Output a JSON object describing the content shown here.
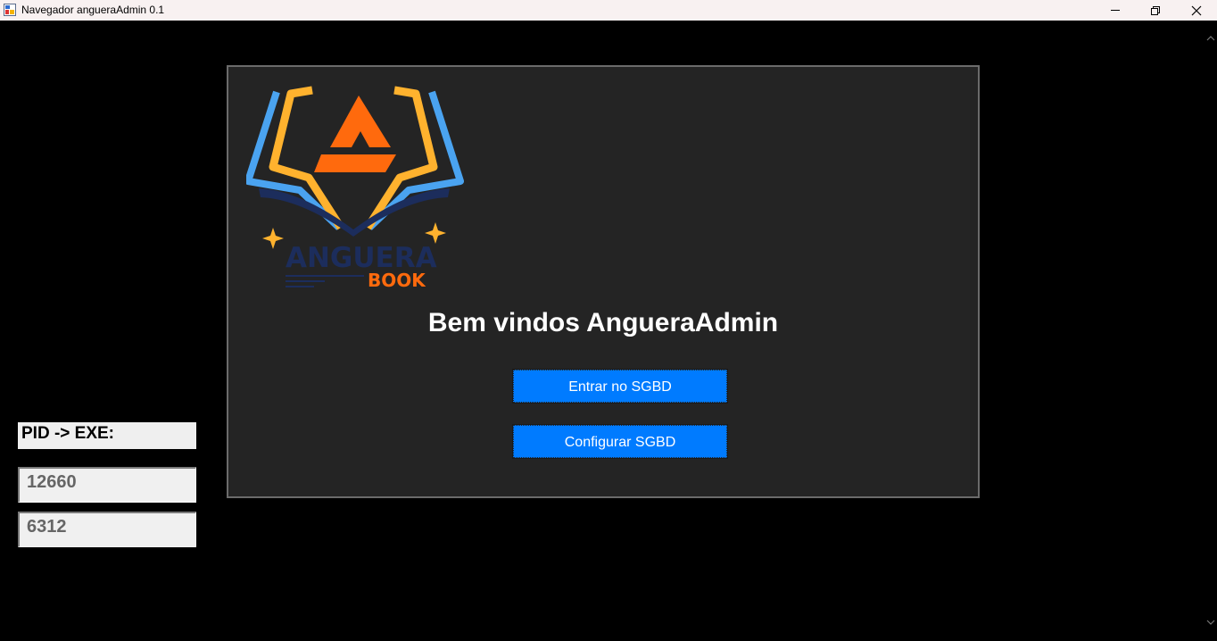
{
  "window": {
    "title": "Navegador angueraAdmin 0.1",
    "icon": "app-window-icon",
    "controls": [
      "minimize-icon",
      "restore-icon",
      "close-icon"
    ]
  },
  "main": {
    "logo": {
      "brand_word": "ANGUERA",
      "brand_sub": "BOOK",
      "colors": {
        "blue": "#4aa3f0",
        "yellow": "#ffb22e",
        "orange": "#ff6a0d",
        "navy": "#1c2d5c"
      }
    },
    "welcome_text": "Bem vindos AngueraAdmin",
    "buttons": {
      "enter_label": "Entrar no SGBD",
      "config_label": "Configurar SGBD"
    },
    "accent_color": "#007bff"
  },
  "sidebar": {
    "pid_label": "PID -> EXE:",
    "pids": [
      "12660",
      "6312"
    ]
  }
}
